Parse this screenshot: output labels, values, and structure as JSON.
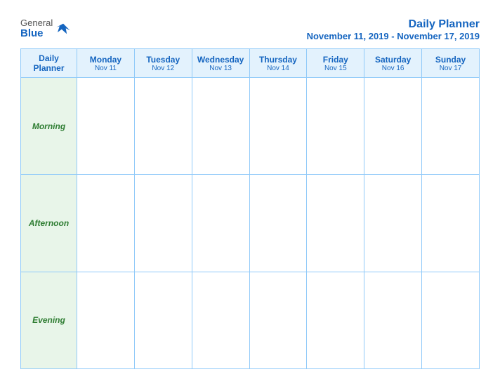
{
  "logo": {
    "general": "General",
    "blue": "Blue"
  },
  "title": {
    "main": "Daily Planner",
    "date_range": "November 11, 2019 - November 17, 2019"
  },
  "columns": [
    {
      "day": "Daily\nPlanner",
      "date": ""
    },
    {
      "day": "Monday",
      "date": "Nov 11"
    },
    {
      "day": "Tuesday",
      "date": "Nov 12"
    },
    {
      "day": "Wednesday",
      "date": "Nov 13"
    },
    {
      "day": "Thursday",
      "date": "Nov 14"
    },
    {
      "day": "Friday",
      "date": "Nov 15"
    },
    {
      "day": "Saturday",
      "date": "Nov 16"
    },
    {
      "day": "Sunday",
      "date": "Nov 17"
    }
  ],
  "rows": [
    {
      "label": "Morning"
    },
    {
      "label": "Afternoon"
    },
    {
      "label": "Evening"
    }
  ]
}
